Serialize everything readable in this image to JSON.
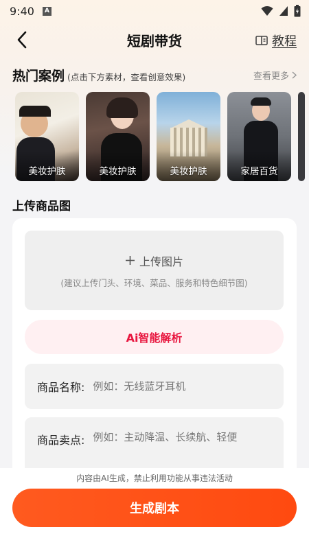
{
  "status_bar": {
    "time": "9:40",
    "notification_badge": "A"
  },
  "header": {
    "title": "短剧带货",
    "tutorial_label": "教程"
  },
  "hot_cases": {
    "title": "热门案例",
    "hint": "(点击下方素材，查看创意效果)",
    "see_more": "查看更多",
    "items": [
      {
        "label": "美妆护肤"
      },
      {
        "label": "美妆护肤"
      },
      {
        "label": "美妆护肤"
      },
      {
        "label": "家居百货"
      }
    ]
  },
  "upload_section": {
    "title": "上传商品图",
    "upload_label": "上传图片",
    "upload_hint": "(建议上传门头、环境、菜品、服务和特色细节图)",
    "ai_button": "Ai智能解析"
  },
  "form": {
    "name_label": "商品名称:",
    "name_placeholder": "例如：无线蓝牙耳机",
    "selling_label": "商品卖点:",
    "selling_placeholder": "例如：主动降温、长续航、轻便"
  },
  "footer": {
    "disclaimer": "内容由AI生成，禁止利用功能从事违法活动",
    "generate_button": "生成剧本"
  },
  "colors": {
    "accent": "#ff5a1f",
    "ai_text": "#e8163f",
    "ai_bg": "#fff0f2"
  }
}
